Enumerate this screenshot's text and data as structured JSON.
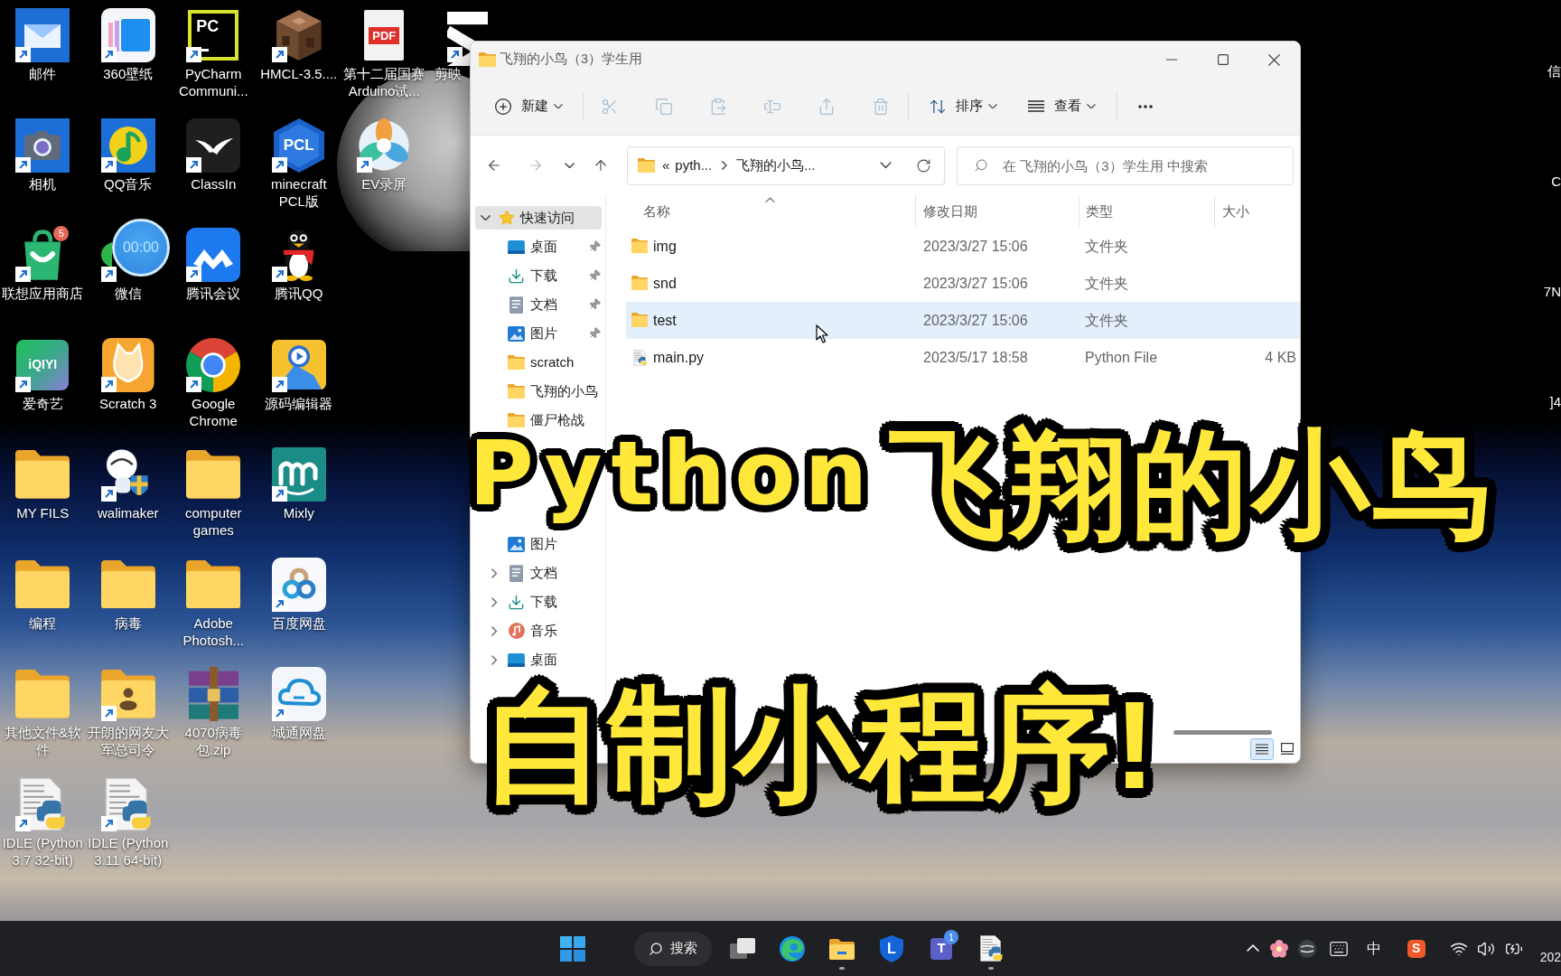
{
  "desktop": {
    "rows": [
      [
        {
          "label": "邮件",
          "kind": "mail",
          "shortcut": true
        },
        {
          "label": "360壁纸",
          "kind": "wallpaper",
          "shortcut": true
        },
        {
          "label": "PyCharm Communi...",
          "kind": "pycharm",
          "shortcut": true,
          "logo_text": "PC"
        },
        {
          "label": "HMCL-3.5....",
          "kind": "block",
          "shortcut": true
        },
        {
          "label": "第十二届国赛Arduino试...",
          "kind": "pdf",
          "shortcut": false,
          "logo_text": "PDF"
        },
        {
          "label": "剪映",
          "kind": "capcut",
          "shortcut": true
        }
      ],
      [
        {
          "label": "相机",
          "kind": "camera",
          "shortcut": true
        },
        {
          "label": "QQ音乐",
          "kind": "music",
          "shortcut": true
        },
        {
          "label": "ClassIn",
          "kind": "classin",
          "shortcut": true
        },
        {
          "label": "minecraft PCL版",
          "kind": "pcl",
          "shortcut": true,
          "logo_text": "PCL"
        },
        {
          "label": "EV录屏",
          "kind": "ev",
          "shortcut": true
        }
      ],
      [
        {
          "label": "联想应用商店",
          "kind": "store",
          "shortcut": true,
          "badge": "5"
        },
        {
          "label": "微信",
          "kind": "wechat",
          "shortcut": true
        },
        {
          "label": "腾讯会议",
          "kind": "meeting",
          "shortcut": true
        },
        {
          "label": "腾讯QQ",
          "kind": "penguin",
          "shortcut": true
        }
      ],
      [
        {
          "label": "爱奇艺",
          "kind": "iqiyi",
          "shortcut": true,
          "logo_text": "iQIYI"
        },
        {
          "label": "Scratch 3",
          "kind": "scratch",
          "shortcut": true
        },
        {
          "label": "Google Chrome",
          "kind": "chrome",
          "shortcut": true
        },
        {
          "label": "源码编辑器",
          "kind": "editor",
          "shortcut": true
        }
      ],
      [
        {
          "label": "MY FILS",
          "kind": "folder",
          "shortcut": false
        },
        {
          "label": "walimaker",
          "kind": "robot",
          "shortcut": true
        },
        {
          "label": "computer games",
          "kind": "folder",
          "shortcut": false
        },
        {
          "label": "Mixly",
          "kind": "mixly",
          "shortcut": true
        }
      ],
      [
        {
          "label": "编程",
          "kind": "folder",
          "shortcut": false
        },
        {
          "label": "病毒",
          "kind": "folder",
          "shortcut": false
        },
        {
          "label": "Adobe Photosh...",
          "kind": "folder",
          "shortcut": false
        },
        {
          "label": "百度网盘",
          "kind": "netdisk",
          "shortcut": true
        }
      ],
      [
        {
          "label": "其他文件&软件",
          "kind": "folder",
          "shortcut": false
        },
        {
          "label": "开朗的网友大军总司令",
          "kind": "userfolder",
          "shortcut": true
        },
        {
          "label": "4070病毒包.zip",
          "kind": "archive",
          "shortcut": false
        },
        {
          "label": "城通网盘",
          "kind": "cloud",
          "shortcut": true
        }
      ],
      [
        {
          "label": "IDLE (Python 3.7 32-bit)",
          "kind": "python",
          "shortcut": true
        },
        {
          "label": "IDLE (Python 3.11 64-bit)",
          "kind": "python",
          "shortcut": true
        }
      ]
    ],
    "timer": {
      "time": "00:00"
    },
    "edge_labels": [
      "信",
      "C",
      "7N",
      "]4"
    ]
  },
  "explorer": {
    "title": "飞翔的小鸟（3）学生用",
    "toolbar": [
      {
        "kind": "new",
        "label": "新建",
        "disabled": false
      },
      {
        "kind": "cut",
        "disabled": true
      },
      {
        "kind": "copy",
        "disabled": true
      },
      {
        "kind": "paste",
        "disabled": true
      },
      {
        "kind": "rename",
        "disabled": true
      },
      {
        "kind": "share",
        "disabled": true
      },
      {
        "kind": "delete",
        "disabled": true
      },
      {
        "kind": "sort",
        "label": "排序",
        "disabled": false
      },
      {
        "kind": "view",
        "label": "查看",
        "disabled": false
      },
      {
        "kind": "more",
        "disabled": false
      }
    ],
    "nav_buttons": [
      {
        "kind": "back",
        "disabled": false
      },
      {
        "kind": "forward",
        "disabled": true
      },
      {
        "kind": "recent",
        "disabled": false
      },
      {
        "kind": "up",
        "disabled": false
      }
    ],
    "address": {
      "overflow": "«",
      "segments": [
        "pyth...",
        "飞翔的小鸟..."
      ]
    },
    "search": {
      "placeholder": "在 飞翔的小鸟（3）学生用 中搜索"
    },
    "nav_pane": {
      "quick_access": {
        "label": "快速访问",
        "expanded": true,
        "selected": true,
        "children": [
          {
            "label": "桌面",
            "kind": "desktop",
            "pinned": true
          },
          {
            "label": "下载",
            "kind": "download",
            "pinned": true
          },
          {
            "label": "文档",
            "kind": "document",
            "pinned": true
          },
          {
            "label": "图片",
            "kind": "picture",
            "pinned": true
          },
          {
            "label": "scratch",
            "kind": "folder",
            "pinned": false
          },
          {
            "label": "飞翔的小鸟",
            "kind": "folder",
            "pinned": false
          },
          {
            "label": "僵尸枪战",
            "kind": "folder",
            "pinned": false
          }
        ]
      },
      "this_pc": [
        {
          "label": "图片",
          "kind": "picture"
        },
        {
          "label": "文档",
          "kind": "document",
          "expanded": false
        },
        {
          "label": "下载",
          "kind": "download",
          "expanded": false
        },
        {
          "label": "音乐",
          "kind": "music",
          "expanded": false
        },
        {
          "label": "桌面",
          "kind": "desktop",
          "expanded": false
        }
      ]
    },
    "columns": [
      {
        "label": "名称",
        "sorted": true
      },
      {
        "label": "修改日期",
        "sorted": false
      },
      {
        "label": "类型",
        "sorted": false
      },
      {
        "label": "大小",
        "sorted": false
      }
    ],
    "rows": [
      {
        "name": "img",
        "kind": "folder",
        "modified": "2023/3/27 15:06",
        "type": "文件夹",
        "hovered": false
      },
      {
        "name": "snd",
        "kind": "folder",
        "modified": "2023/3/27 15:06",
        "type": "文件夹",
        "hovered": false
      },
      {
        "name": "test",
        "kind": "folder",
        "modified": "2023/3/27 15:06",
        "type": "文件夹",
        "hovered": true
      },
      {
        "name": "main.py",
        "kind": "python",
        "modified": "2023/5/17 18:58",
        "type": "Python File",
        "size": "4 KB",
        "hovered": false
      }
    ],
    "view_modes": [
      {
        "kind": "details",
        "selected": true
      },
      {
        "kind": "tiles",
        "selected": false
      }
    ]
  },
  "overlay": {
    "title_latin": "Python",
    "title_cjk": "飞翔的小鸟",
    "subtitle": "自制小程序!"
  },
  "taskbar": {
    "apps": [
      {
        "kind": "start",
        "running": false
      },
      {
        "kind": "search",
        "label": "搜索",
        "running": false
      },
      {
        "kind": "taskview",
        "running": false
      },
      {
        "kind": "edge",
        "running": false
      },
      {
        "kind": "explorer",
        "running": true
      },
      {
        "kind": "shield",
        "logo_text": "L",
        "running": false
      },
      {
        "kind": "teams",
        "logo_text": "T",
        "badge": "1",
        "running": false
      },
      {
        "kind": "python",
        "running": true
      }
    ],
    "tray": [
      {
        "kind": "chevron"
      },
      {
        "kind": "flower"
      },
      {
        "kind": "globe"
      },
      {
        "kind": "keyboard"
      },
      {
        "kind": "ime",
        "label": "中"
      },
      {
        "kind": "sogou",
        "logo_text": "S"
      },
      {
        "kind": "wifi"
      },
      {
        "kind": "volume"
      },
      {
        "kind": "battery"
      }
    ],
    "clock": "202"
  }
}
